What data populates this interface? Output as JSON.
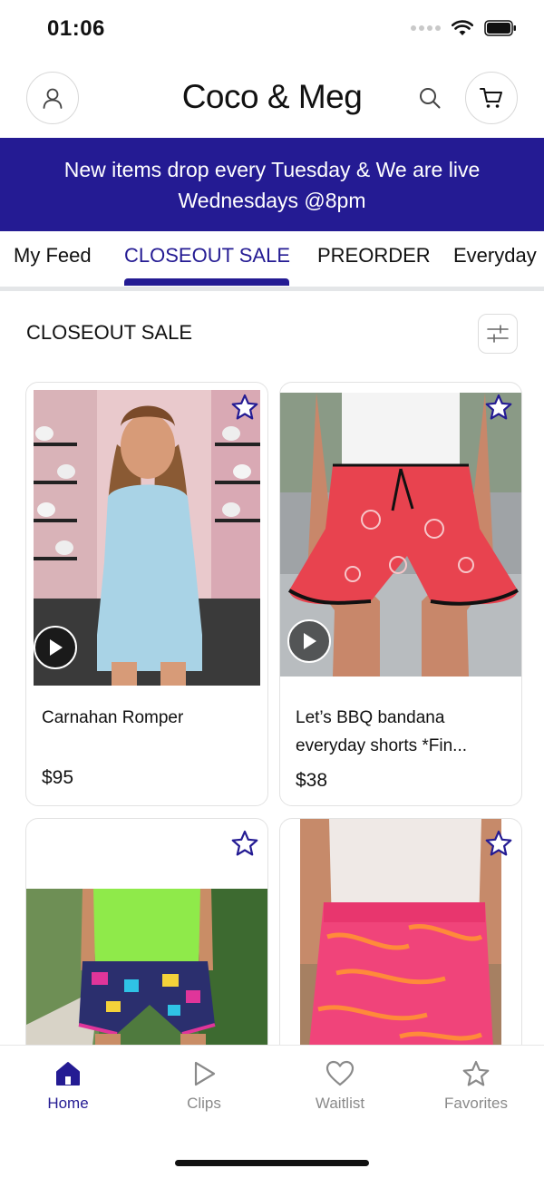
{
  "status_bar": {
    "time": "01:06",
    "icons": [
      "signal-dots",
      "wifi-icon",
      "battery-icon"
    ]
  },
  "header": {
    "title": "Coco & Meg",
    "icons": {
      "left": "profile-icon",
      "search": "search-icon",
      "right": "cart-icon"
    }
  },
  "announcement": {
    "line1": "New items drop every Tuesday & We are live",
    "line2": "Wednesdays @8pm",
    "background": "#241b93"
  },
  "tabs": [
    {
      "label": "My Feed",
      "active": false
    },
    {
      "label": "CLOSEOUT SALE",
      "active": true
    },
    {
      "label": "PREORDER",
      "active": false
    },
    {
      "label": "Everyday",
      "active": false
    }
  ],
  "section": {
    "title": "CLOSEOUT SALE",
    "filter_icon": "sliders-icon"
  },
  "products": [
    {
      "name": "Carnahan Romper",
      "price": "$95",
      "has_video": true,
      "favorite": false
    },
    {
      "name": "Let’s BBQ bandana everyday shorts *Fin...",
      "price": "$38",
      "has_video": true,
      "favorite": false
    },
    {
      "name": "",
      "price": "",
      "has_video": false,
      "favorite": false
    },
    {
      "name": "",
      "price": "",
      "has_video": false,
      "favorite": false
    }
  ],
  "bottom_nav": [
    {
      "label": "Home",
      "icon": "home-icon",
      "active": true
    },
    {
      "label": "Clips",
      "icon": "play-outline-icon",
      "active": false
    },
    {
      "label": "Waitlist",
      "icon": "heart-icon",
      "active": false
    },
    {
      "label": "Favorites",
      "icon": "star-icon",
      "active": false
    }
  ],
  "colors": {
    "accent": "#241b93",
    "inactive": "#8a8a8a"
  }
}
